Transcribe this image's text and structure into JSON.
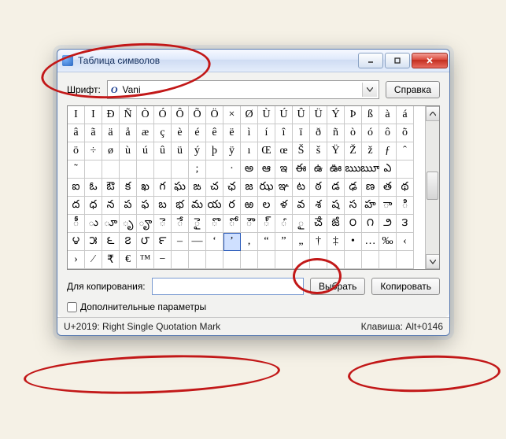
{
  "window": {
    "title": "Таблица символов"
  },
  "font_row": {
    "label": "Шрифт:",
    "icon_letter": "O",
    "value": "Vani",
    "help_button": "Справка"
  },
  "grid": {
    "rows": [
      [
        "I",
        "I",
        "Đ",
        "Ñ",
        "Ò",
        "Ó",
        "Ô",
        "Õ",
        "Ö",
        "×",
        "Ø",
        "Ù",
        "Ú",
        "Û",
        "Ü",
        "Ý",
        "Þ",
        "ß",
        "à",
        "á"
      ],
      [
        "â",
        "ã",
        "ä",
        "å",
        "æ",
        "ç",
        "è",
        "é",
        "ê",
        "ë",
        "ì",
        "í",
        "î",
        "ï",
        "ð",
        "ñ",
        "ò",
        "ó",
        "ô",
        "õ"
      ],
      [
        "ö",
        "÷",
        "ø",
        "ù",
        "ú",
        "û",
        "ü",
        "ý",
        "þ",
        "ÿ",
        "ı",
        "Œ",
        "œ",
        "Š",
        "š",
        "Ÿ",
        "Ž",
        "ž",
        "ƒ",
        "ˆ"
      ],
      [
        "˜",
        "",
        "",
        "",
        "",
        "",
        "",
        ";",
        "",
        "·",
        "అ",
        "ఆ",
        "ఇ",
        "ఈ",
        "ఉ",
        "ఊ",
        "ఋ",
        "ౠ",
        "ఎ",
        ""
      ],
      [
        "ఐ",
        "ఓ",
        "ఔ",
        "క",
        "ఖ",
        "గ",
        "ఘ",
        "ఙ",
        "చ",
        "ఛ",
        "జ",
        "ఝ",
        "ఞ",
        "ట",
        "ఠ",
        "డ",
        "ఢ",
        "ణ",
        "త",
        "థ"
      ],
      [
        "ద",
        "ధ",
        "న",
        "ప",
        "ఫ",
        "బ",
        "భ",
        "మ",
        "య",
        "ర",
        "ఱ",
        "ల",
        "ళ",
        "వ",
        "శ",
        "ష",
        "స",
        "హ",
        "ా",
        "ి"
      ],
      [
        "ీ",
        "ు",
        "ూ",
        "ృ",
        "ౄ",
        "ె",
        "ే",
        "ై",
        "ొ",
        "ో",
        "ౌ",
        "్",
        "ౕ",
        "ౖ",
        "ౘ",
        "ౙ",
        "౦",
        "౧",
        "౨",
        "౩"
      ],
      [
        "౪",
        "౫",
        "౬",
        "౭",
        "౮",
        "౯",
        "–",
        "—",
        "‘",
        "’",
        "‚",
        "“",
        "”",
        "„",
        "†",
        "‡",
        "•",
        "…",
        "‰",
        "‹"
      ],
      [
        "›",
        "⁄",
        "₹",
        "€",
        "™",
        "−",
        "",
        "",
        "",
        "",
        "",
        "",
        "",
        "",
        "",
        "",
        "",
        "",
        "",
        ""
      ]
    ],
    "selected": {
      "row": 7,
      "col": 9
    }
  },
  "copy": {
    "label": "Для копирования:",
    "value": "",
    "select_button": "Выбрать",
    "copy_button": "Копировать"
  },
  "advanced": {
    "checkbox_label": "Дополнительные параметры",
    "checked": false
  },
  "status": {
    "left": "U+2019: Right Single Quotation Mark",
    "right": "Клавиша: Alt+0146"
  }
}
